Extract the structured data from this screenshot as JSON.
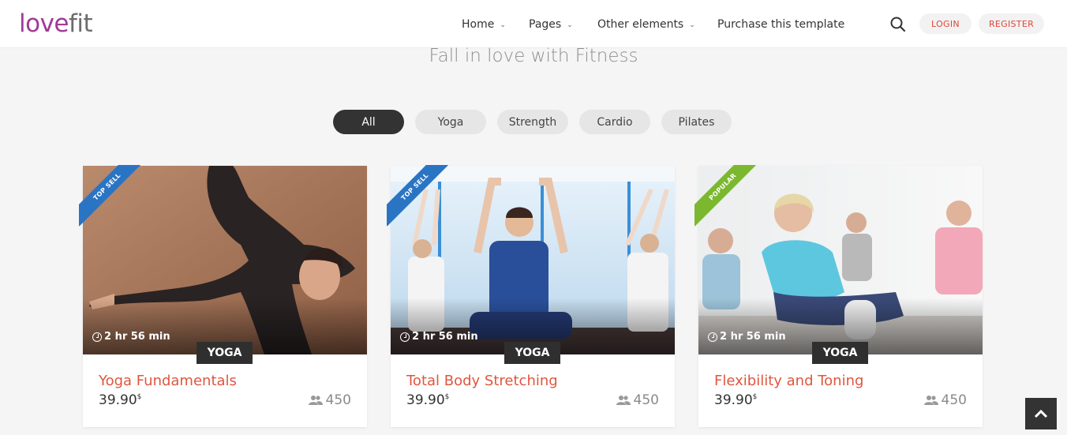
{
  "header": {
    "logo_love": "love",
    "logo_fit": "fit",
    "nav": [
      {
        "label": "Home",
        "has_dropdown": true
      },
      {
        "label": "Pages",
        "has_dropdown": true
      },
      {
        "label": "Other elements",
        "has_dropdown": true
      },
      {
        "label": "Purchase this template",
        "has_dropdown": false
      }
    ],
    "login_label": "LOGIN",
    "register_label": "REGISTER"
  },
  "tagline": "Fall in love with Fitness",
  "filters": [
    {
      "label": "All",
      "active": true
    },
    {
      "label": "Yoga",
      "active": false
    },
    {
      "label": "Strength",
      "active": false
    },
    {
      "label": "Cardio",
      "active": false
    },
    {
      "label": "Pilates",
      "active": false
    }
  ],
  "cards": [
    {
      "ribbon": "TOP SELL",
      "ribbon_color": "#2a74c4",
      "duration": "2 hr 56 min",
      "category": "YOGA",
      "title": "Yoga Fundamentals",
      "price": "39.90",
      "currency": "$",
      "members": "450"
    },
    {
      "ribbon": "TOP SELL",
      "ribbon_color": "#2a74c4",
      "duration": "2 hr 56 min",
      "category": "YOGA",
      "title": "Total Body Stretching",
      "price": "39.90",
      "currency": "$",
      "members": "450"
    },
    {
      "ribbon": "POPULAR",
      "ribbon_color": "#7cb82f",
      "duration": "2 hr 56 min",
      "category": "YOGA",
      "title": "Flexibility and Toning",
      "price": "39.90",
      "currency": "$",
      "members": "450"
    }
  ],
  "colors": {
    "brand": "#a03a97",
    "accent": "#e0563f",
    "dark": "#333333"
  },
  "icons": {
    "search": "search-icon",
    "members": "users-icon",
    "duration": "clock-icon",
    "back_to_top": "chevron-up-icon"
  }
}
